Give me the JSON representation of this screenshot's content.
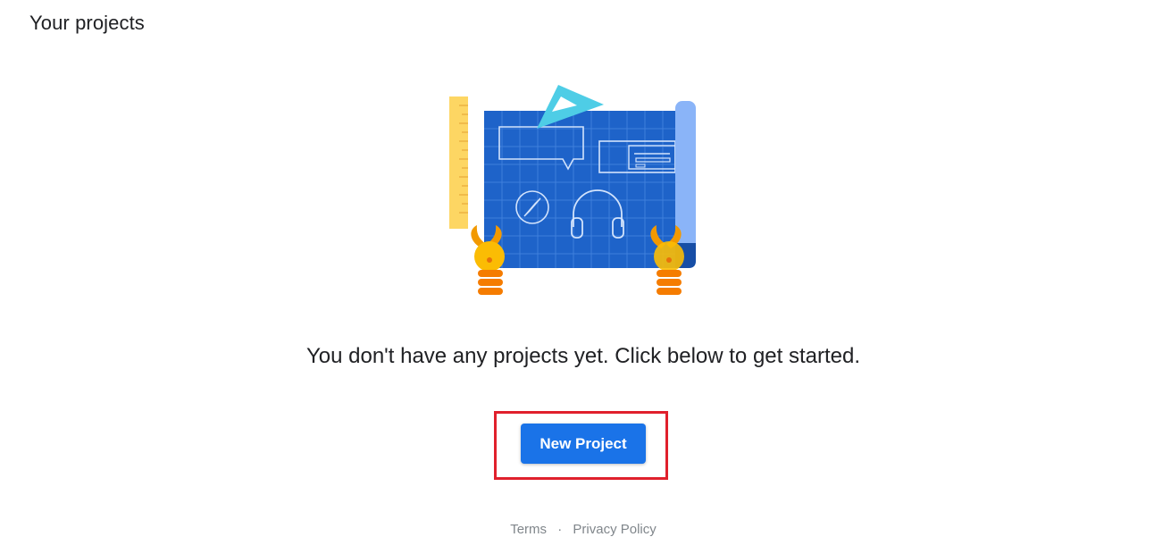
{
  "header": {
    "title": "Your projects"
  },
  "empty_state": {
    "illustration": "blueprint-illustration",
    "message": "You don't have any projects yet. Click below to get started."
  },
  "actions": {
    "new_project_label": "New Project"
  },
  "footer": {
    "terms_label": "Terms",
    "separator": "·",
    "privacy_label": "Privacy Policy"
  },
  "colors": {
    "primary_button": "#1a73e8",
    "highlight_border": "#e0202c",
    "blueprint": "#1e63c9",
    "text": "#202124",
    "footer_text": "#80868b"
  }
}
